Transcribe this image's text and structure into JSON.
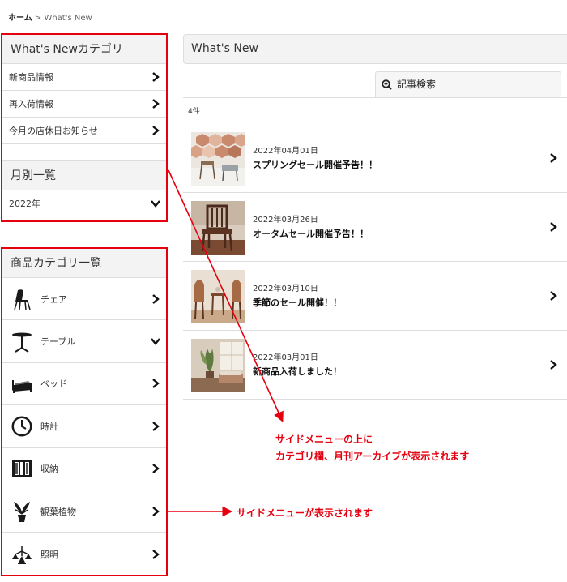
{
  "breadcrumb": {
    "home": "ホーム",
    "separator": " > ",
    "current": "What's New"
  },
  "sidebar": {
    "category_title": "What's Newカテゴリ",
    "categories": [
      {
        "label": "新商品情報"
      },
      {
        "label": "再入荷情報"
      },
      {
        "label": "今月の店休日お知らせ"
      }
    ],
    "monthly_title": "月別一覧",
    "monthly_selected": "2022年"
  },
  "product_categories": {
    "title": "商品カテゴリ一覧",
    "items": [
      {
        "label": "チェア",
        "icon": "chair-icon",
        "chevron": "right"
      },
      {
        "label": "テーブル",
        "icon": "table-icon",
        "chevron": "down"
      },
      {
        "label": "ベッド",
        "icon": "bed-icon",
        "chevron": "right"
      },
      {
        "label": "時計",
        "icon": "clock-icon",
        "chevron": "right"
      },
      {
        "label": "収納",
        "icon": "storage-icon",
        "chevron": "right"
      },
      {
        "label": "観葉植物",
        "icon": "plant-icon",
        "chevron": "right"
      },
      {
        "label": "照明",
        "icon": "lighting-icon",
        "chevron": "right"
      }
    ]
  },
  "main": {
    "title": "What's New",
    "search_tab": "記事検索",
    "count": "4件",
    "news": [
      {
        "date": "2022年04月01日",
        "title": "スプリングセール開催予告！！"
      },
      {
        "date": "2022年03月26日",
        "title": "オータムセール開催予告！！"
      },
      {
        "date": "2022年03月10日",
        "title": "季節のセール開催！！"
      },
      {
        "date": "2022年03月01日",
        "title": "新商品入荷しました！"
      }
    ]
  },
  "annotations": {
    "note1_line1": "サイドメニューの上に",
    "note1_line2": "カテゴリ欄、月刊アーカイブが表示されます",
    "note2": "サイドメニューが表示されます"
  },
  "colors": {
    "annotation_red": "#e6000f",
    "panel_bg": "#f3f3f3",
    "border": "#dddddd"
  }
}
